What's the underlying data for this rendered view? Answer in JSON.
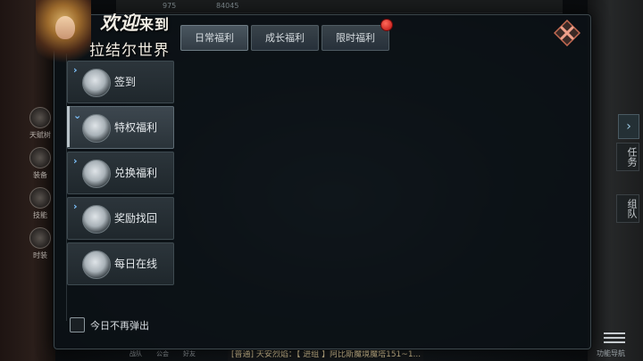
{
  "welcome": {
    "line1_big": "欢迎",
    "line1_small": "来到",
    "line2": "拉结尔世界"
  },
  "tabs": [
    {
      "label": "日常福利",
      "active": true
    },
    {
      "label": "成长福利",
      "active": false
    },
    {
      "label": "限时福利",
      "active": false,
      "badge": true
    }
  ],
  "menu": [
    {
      "label": "签到",
      "icon": "scroll-icon",
      "active": false
    },
    {
      "label": "特权福利",
      "icon": "card-icon",
      "active": true
    },
    {
      "label": "兑换福利",
      "icon": "emblem-icon",
      "active": false
    },
    {
      "label": "奖励找回",
      "icon": "gift-icon",
      "active": false
    },
    {
      "label": "每日在线",
      "icon": "clock-icon",
      "active": false
    }
  ],
  "checkbox": {
    "label": "今日不再弹出",
    "checked": false
  },
  "background": {
    "top_numbers": [
      "975",
      "84045"
    ],
    "side_buttons": [
      "天赋树",
      "装备",
      "技能",
      "时装"
    ],
    "right_tabs": [
      "任务",
      "组队"
    ],
    "chat_text": "[普通] 天安烈焰：【 进组 】阿比斯魔境魔塔151~1...",
    "bottom_nav": [
      "战队",
      "公会",
      "好友"
    ],
    "bottom_right_label": "功能导航"
  },
  "colors": {
    "accent": "#7fc4ff",
    "badge": "#d01515",
    "panel": "#0c1216"
  }
}
